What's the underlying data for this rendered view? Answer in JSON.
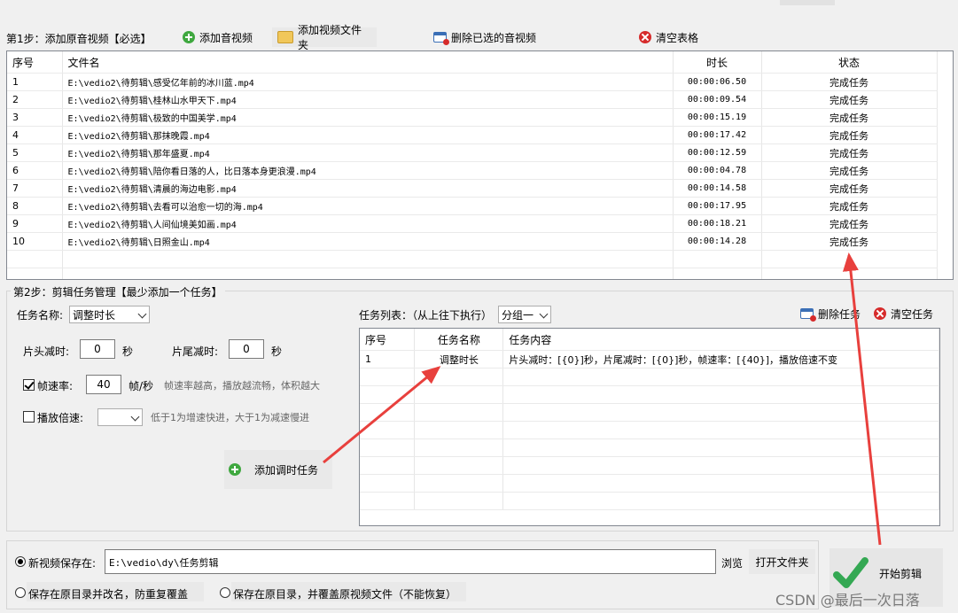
{
  "step1": {
    "label": "第1步：添加原音视频【必选】",
    "add_av": "添加音视频",
    "add_folder": "添加视频文件夹",
    "delete_selected": "删除已选的音视频",
    "clear_table": "清空表格"
  },
  "file_table": {
    "headers": [
      "序号",
      "文件名",
      "时长",
      "状态"
    ],
    "rows": [
      [
        "1",
        "E:\\vedio2\\待剪辑\\感受亿年前的冰川蓝.mp4",
        "00:00:06.50",
        "完成任务"
      ],
      [
        "2",
        "E:\\vedio2\\待剪辑\\桂林山水甲天下.mp4",
        "00:00:09.54",
        "完成任务"
      ],
      [
        "3",
        "E:\\vedio2\\待剪辑\\极致的中国美学.mp4",
        "00:00:15.19",
        "完成任务"
      ],
      [
        "4",
        "E:\\vedio2\\待剪辑\\那抹晚霞.mp4",
        "00:00:17.42",
        "完成任务"
      ],
      [
        "5",
        "E:\\vedio2\\待剪辑\\那年盛夏.mp4",
        "00:00:12.59",
        "完成任务"
      ],
      [
        "6",
        "E:\\vedio2\\待剪辑\\陪你看日落的人，比日落本身更浪漫.mp4",
        "00:00:04.78",
        "完成任务"
      ],
      [
        "7",
        "E:\\vedio2\\待剪辑\\清晨的海边电影.mp4",
        "00:00:14.58",
        "完成任务"
      ],
      [
        "8",
        "E:\\vedio2\\待剪辑\\去看可以治愈一切的海.mp4",
        "00:00:17.95",
        "完成任务"
      ],
      [
        "9",
        "E:\\vedio2\\待剪辑\\人间仙境美如画.mp4",
        "00:00:18.21",
        "完成任务"
      ],
      [
        "10",
        "E:\\vedio2\\待剪辑\\日照金山.mp4",
        "00:00:14.28",
        "完成任务"
      ]
    ]
  },
  "step2": {
    "label": "第2步：剪辑任务管理【最少添加一个任务】",
    "task_name_label": "任务名称:",
    "task_name_value": "调整时长",
    "head_cut_label": "片头减时:",
    "head_cut_value": "0",
    "tail_cut_label": "片尾减时:",
    "tail_cut_value": "0",
    "seconds": "秒",
    "fps_label": "帧速率:",
    "fps_value": "40",
    "fps_unit": "帧/秒",
    "fps_hint": "帧速率越高，播放越流畅，体积越大",
    "speed_label": "播放倍速:",
    "speed_hint": "低于1为增速快进，大于1为减速慢进",
    "add_task": "添加调时任务",
    "task_list_label": "任务列表：（从上往下执行）",
    "group_value": "分组一",
    "delete_task": "删除任务",
    "clear_tasks": "清空任务"
  },
  "task_table": {
    "headers": [
      "序号",
      "任务名称",
      "任务内容"
    ],
    "rows": [
      [
        "1",
        "调整时长",
        "片头减时：[{0}]秒，片尾减时：[{0}]秒，帧速率：[{40}]，播放倍速不变"
      ]
    ]
  },
  "output": {
    "new_save_label": "新视频保存在:",
    "save_path": "E:\\vedio\\dy\\任务剪辑",
    "browse": "浏览",
    "open_folder": "打开文件夹",
    "option_rename": "保存在原目录并改名，防重复覆盖",
    "option_overwrite": "保存在原目录，并覆盖原视频文件（不能恢复）",
    "start": "开始剪辑"
  },
  "watermark": "CSDN @最后一次日落",
  "colors": {
    "arrow": "#e8403d",
    "check_green": "#34a853"
  }
}
